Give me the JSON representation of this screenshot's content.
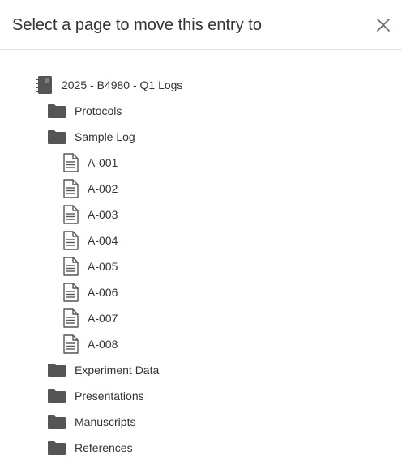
{
  "dialog": {
    "title": "Select a page to move this entry to"
  },
  "tree": {
    "notebook": {
      "label": "2025 - B4980 - Q1 Logs",
      "icon": "notebook-icon"
    },
    "folders_top": [
      {
        "label": "Protocols",
        "icon": "folder-icon"
      },
      {
        "label": "Sample Log",
        "icon": "folder-icon"
      }
    ],
    "pages": [
      {
        "label": "A-001",
        "icon": "document-icon"
      },
      {
        "label": "A-002",
        "icon": "document-icon"
      },
      {
        "label": "A-003",
        "icon": "document-icon"
      },
      {
        "label": "A-004",
        "icon": "document-icon"
      },
      {
        "label": "A-005",
        "icon": "document-icon"
      },
      {
        "label": "A-006",
        "icon": "document-icon"
      },
      {
        "label": "A-007",
        "icon": "document-icon"
      },
      {
        "label": "A-008",
        "icon": "document-icon"
      }
    ],
    "folders_bottom": [
      {
        "label": "Experiment Data",
        "icon": "folder-icon"
      },
      {
        "label": "Presentations",
        "icon": "folder-icon"
      },
      {
        "label": "Manuscripts",
        "icon": "folder-icon"
      },
      {
        "label": "References",
        "icon": "folder-icon"
      }
    ]
  },
  "colors": {
    "icon": "#555555",
    "text": "#333333",
    "divider": "#e5e5e5"
  }
}
